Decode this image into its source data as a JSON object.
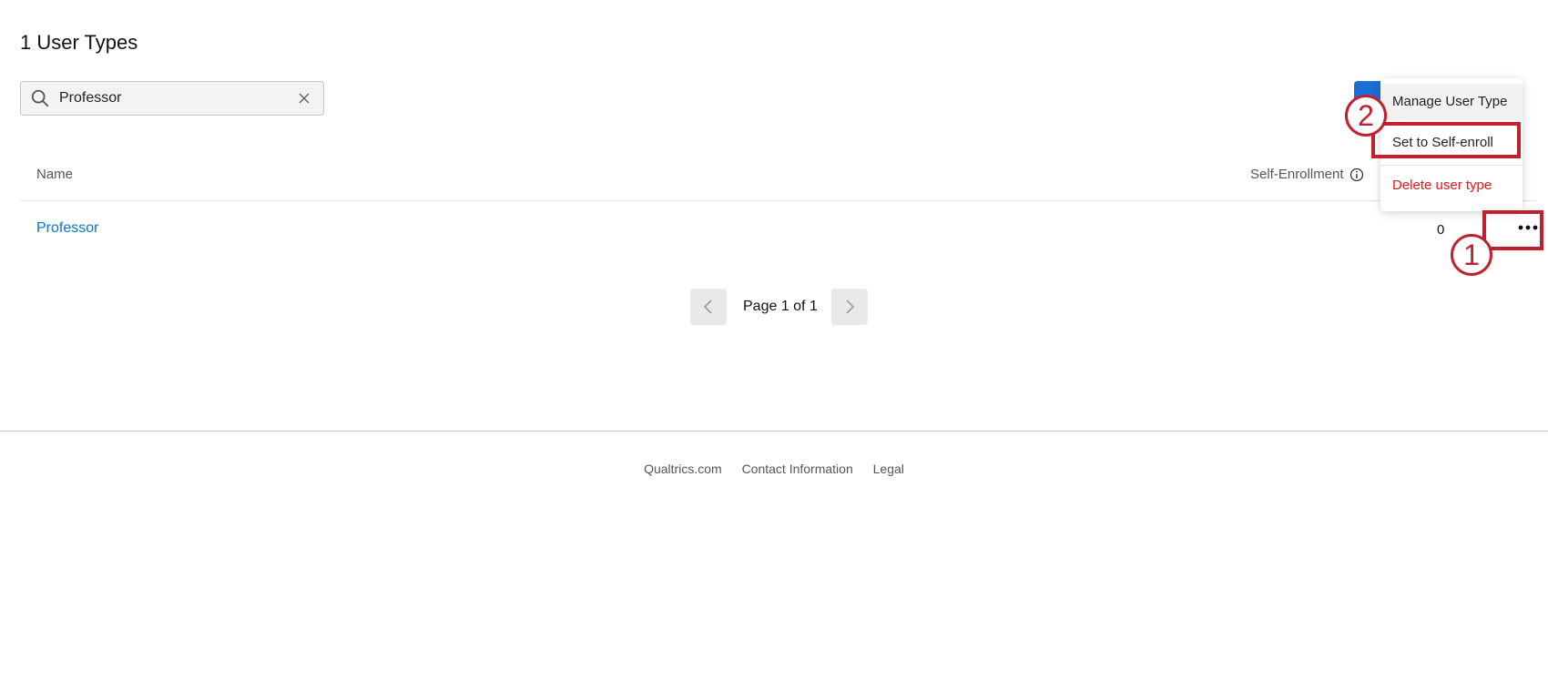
{
  "page": {
    "title": "1 User Types"
  },
  "search": {
    "value": "Professor",
    "icon": "search-icon",
    "clear_icon": "close-icon"
  },
  "table": {
    "columns": {
      "name": "Name",
      "self_enrollment": "Self-Enrollment"
    },
    "rows": [
      {
        "name": "Professor",
        "count": "0"
      }
    ]
  },
  "pagination": {
    "label": "Page 1 of 1"
  },
  "actions_menu": {
    "items": [
      {
        "label": "Manage User Type"
      },
      {
        "label": "Set to Self-enroll"
      },
      {
        "label": "Delete user type"
      }
    ]
  },
  "callouts": {
    "one": "1",
    "two": "2"
  },
  "footer": {
    "links": [
      "Qualtrics.com",
      "Contact Information",
      "Legal"
    ]
  },
  "colors": {
    "accent": "#1b6fd6",
    "link": "#0b74c8",
    "danger": "#e8141b",
    "annotation": "#c1202e"
  }
}
